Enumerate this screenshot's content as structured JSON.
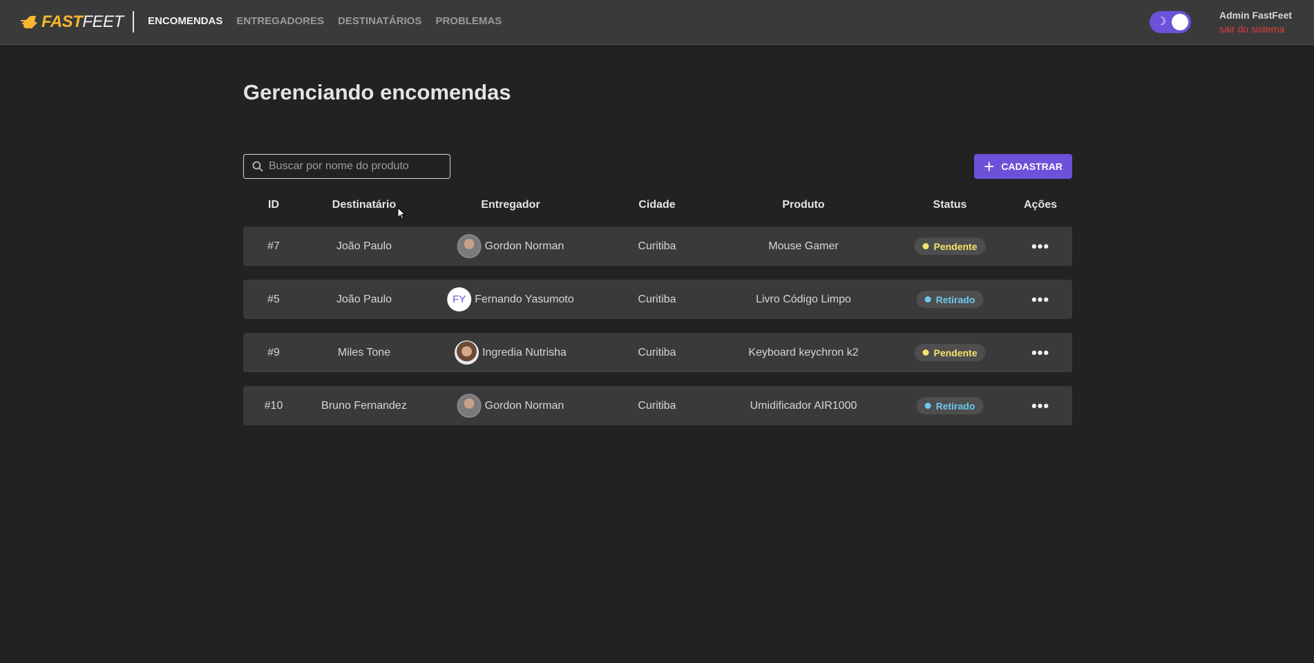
{
  "header": {
    "logo_fast": "FAST",
    "logo_feet": "FEET",
    "nav": [
      {
        "label": "ENCOMENDAS",
        "active": true
      },
      {
        "label": "ENTREGADORES",
        "active": false
      },
      {
        "label": "DESTINATÁRIOS",
        "active": false
      },
      {
        "label": "PROBLEMAS",
        "active": false
      }
    ],
    "theme_toggle": {
      "icon": "moon-icon",
      "state": "dark"
    },
    "user": {
      "name": "Admin FastFeet",
      "logout": "sair do sistema"
    }
  },
  "main": {
    "title": "Gerenciando encomendas",
    "search": {
      "placeholder": "Buscar por nome do produto",
      "value": ""
    },
    "add_button": "CADASTRAR",
    "table": {
      "headers": [
        "ID",
        "Destinatário",
        "Entregador",
        "Cidade",
        "Produto",
        "Status",
        "Ações"
      ],
      "rows": [
        {
          "id": "#7",
          "recipient": "João Paulo",
          "courier": "Gordon Norman",
          "avatar": "photo-m",
          "initials": "",
          "city": "Curitiba",
          "product": "Mouse Gamer",
          "status": "Pendente",
          "status_color": "#f5e56b"
        },
        {
          "id": "#5",
          "recipient": "João Paulo",
          "courier": "Fernando Yasumoto",
          "avatar": "initials",
          "initials": "FY",
          "city": "Curitiba",
          "product": "Livro Código Limpo",
          "status": "Retirado",
          "status_color": "#6ec8f0"
        },
        {
          "id": "#9",
          "recipient": "Miles Tone",
          "courier": "Ingredia Nutrisha",
          "avatar": "photo-f",
          "initials": "",
          "city": "Curitiba",
          "product": "Keyboard keychron k2",
          "status": "Pendente",
          "status_color": "#f5e56b"
        },
        {
          "id": "#10",
          "recipient": "Bruno Fernandez",
          "courier": "Gordon Norman",
          "avatar": "photo-m",
          "initials": "",
          "city": "Curitiba",
          "product": "Umidificador AIR1000",
          "status": "Retirado",
          "status_color": "#6ec8f0"
        }
      ]
    }
  },
  "colors": {
    "accent": "#6b52d8",
    "brand": "#f7b731",
    "logout": "#e0413f"
  }
}
